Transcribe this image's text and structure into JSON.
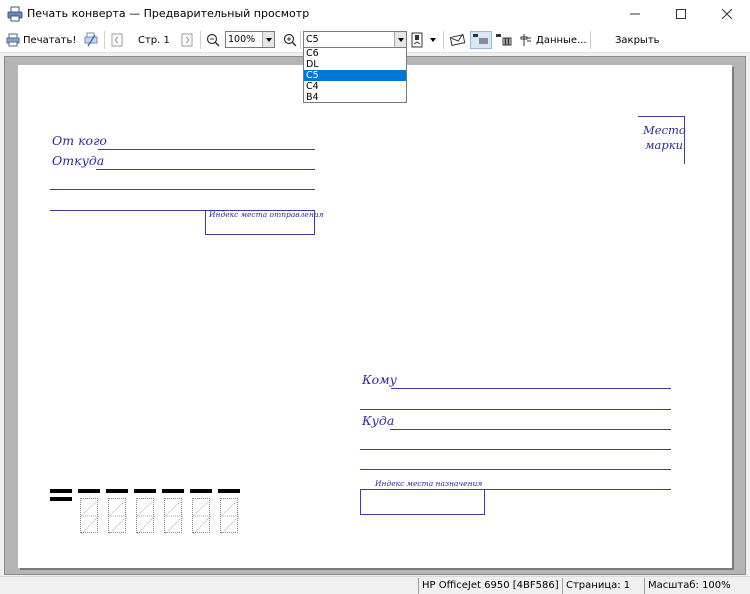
{
  "window": {
    "title": "Печать конверта — Предварительный просмотр",
    "controls": [
      "minimize-icon",
      "maximize-icon",
      "close-icon"
    ]
  },
  "toolbar": {
    "print_label": "Печатать!",
    "page_label": "Стр. 1",
    "zoom_value": "100%",
    "format_value": "C5",
    "data_label": "Данные...",
    "close_label": "Закрыть"
  },
  "format_dropdown": {
    "options": [
      "C6",
      "DL",
      "C5",
      "C4",
      "B4"
    ],
    "selected": "C5"
  },
  "envelope": {
    "from_label": "От кого",
    "from_where_label": "Откуда",
    "sender_index_label": "Индекс места отправления",
    "stamp_label_1": "Место",
    "stamp_label_2": "марки",
    "to_label": "Кому",
    "to_where_label": "Куда",
    "dest_index_label": "Индекс места назначения",
    "line_color": "#3a3aa8"
  },
  "statusbar": {
    "printer": "HP OfficeJet 6950 [4BF586]",
    "page": "Страница: 1",
    "scale": "Масштаб: 100%"
  }
}
